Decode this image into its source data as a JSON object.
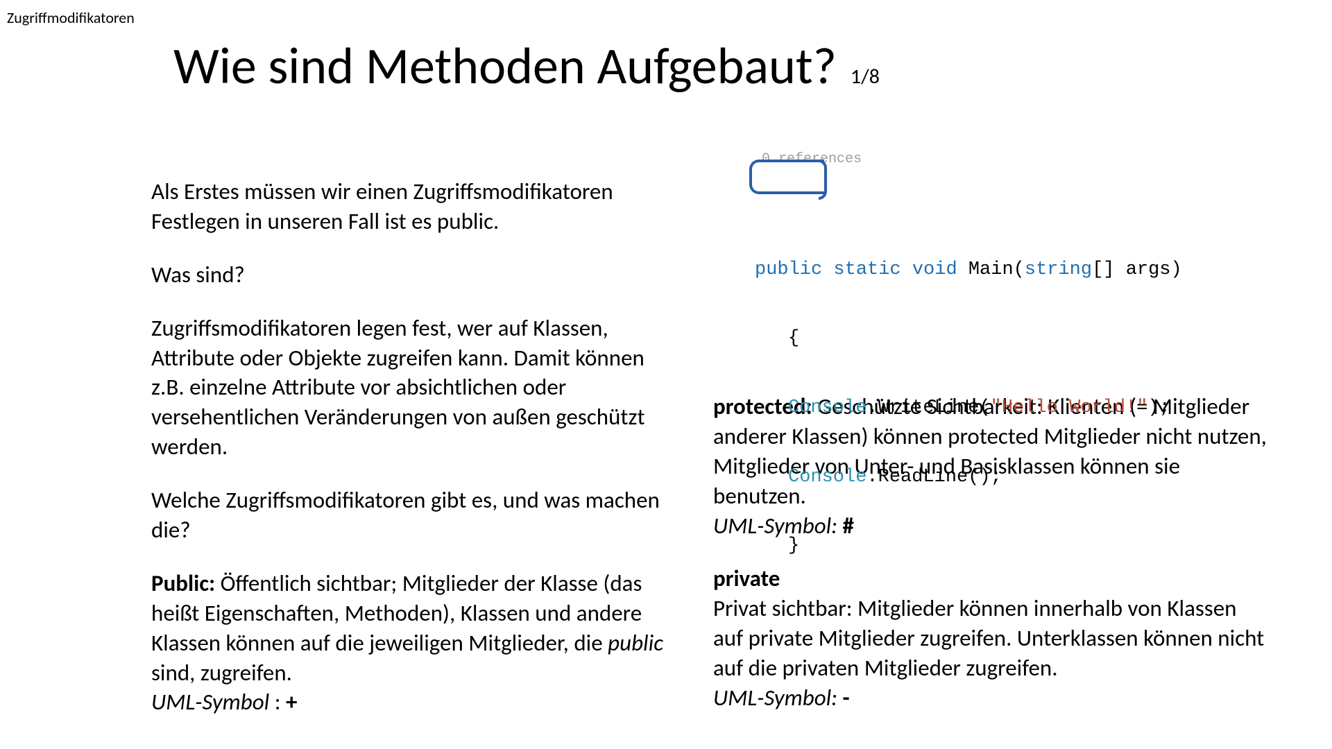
{
  "topic_label": "Zugriffmodifikatoren",
  "title": "Wie sind Methoden Aufgebaut?",
  "pager": "1/8",
  "left": {
    "p1": "Als Erstes müssen wir einen Zugriffsmodifikatoren Festlegen in unseren Fall ist es public.",
    "p2": "Was sind?",
    "p3": "Zugriffsmodifikatoren legen fest, wer auf Klassen, Attribute oder Objekte zugreifen kann. Damit können z.B. einzelne Attribute vor absichtlichen oder versehentlichen Veränderungen von außen geschützt werden.",
    "p4": "Welche Zugriffsmodifikatoren gibt es, und was machen die?",
    "public_label": "Public:",
    "public_body_1": " Öffentlich sichtbar; Mitglieder der Klasse (das heißt Eigenschaften, Methoden), Klassen und andere Klassen können auf die jeweiligen Mitglieder, die ",
    "public_body_italic": "public",
    "public_body_2": " sind, zugreifen.",
    "public_uml_label": "UML-Symbol",
    "public_uml_sep": " : ",
    "public_uml_symbol": "+"
  },
  "right": {
    "protected_label": "protected:",
    "protected_body": " Geschützte Sichtbarkeit: Klienten (= Mitglieder anderer Klassen) können protected Mitglieder nicht nutzen, Mitglieder von Unter- und Basisklassen können sie benutzen.",
    "protected_uml_label": "UML-Symbol:",
    "protected_uml_symbol": " #",
    "private_label": "private",
    "private_body": "Privat sichtbar: Mitglieder können innerhalb von Klassen auf private Mitglieder zugreifen. Unterklassen können nicht auf die privaten Mitglieder zugreifen.",
    "private_uml_label": "UML-Symbol:",
    "private_uml_symbol": " -"
  },
  "code": {
    "refs": "0 references",
    "kw_public": "public",
    "kw_static": "static",
    "kw_void": "void",
    "fn_main": "Main",
    "sig_open": "(",
    "type_string": "string",
    "arr": "[] ",
    "arg": "args",
    "sig_close": ")",
    "brace_open": "{",
    "console1": "Console",
    "dot": ".",
    "writeline": "WriteLine",
    "paren_open": "(",
    "str_hello": "\"Hello World!\"",
    "paren_close_semi": ");",
    "console2": "Console",
    "readline": "ReadLine",
    "empty_call": "();",
    "brace_close": "}"
  }
}
